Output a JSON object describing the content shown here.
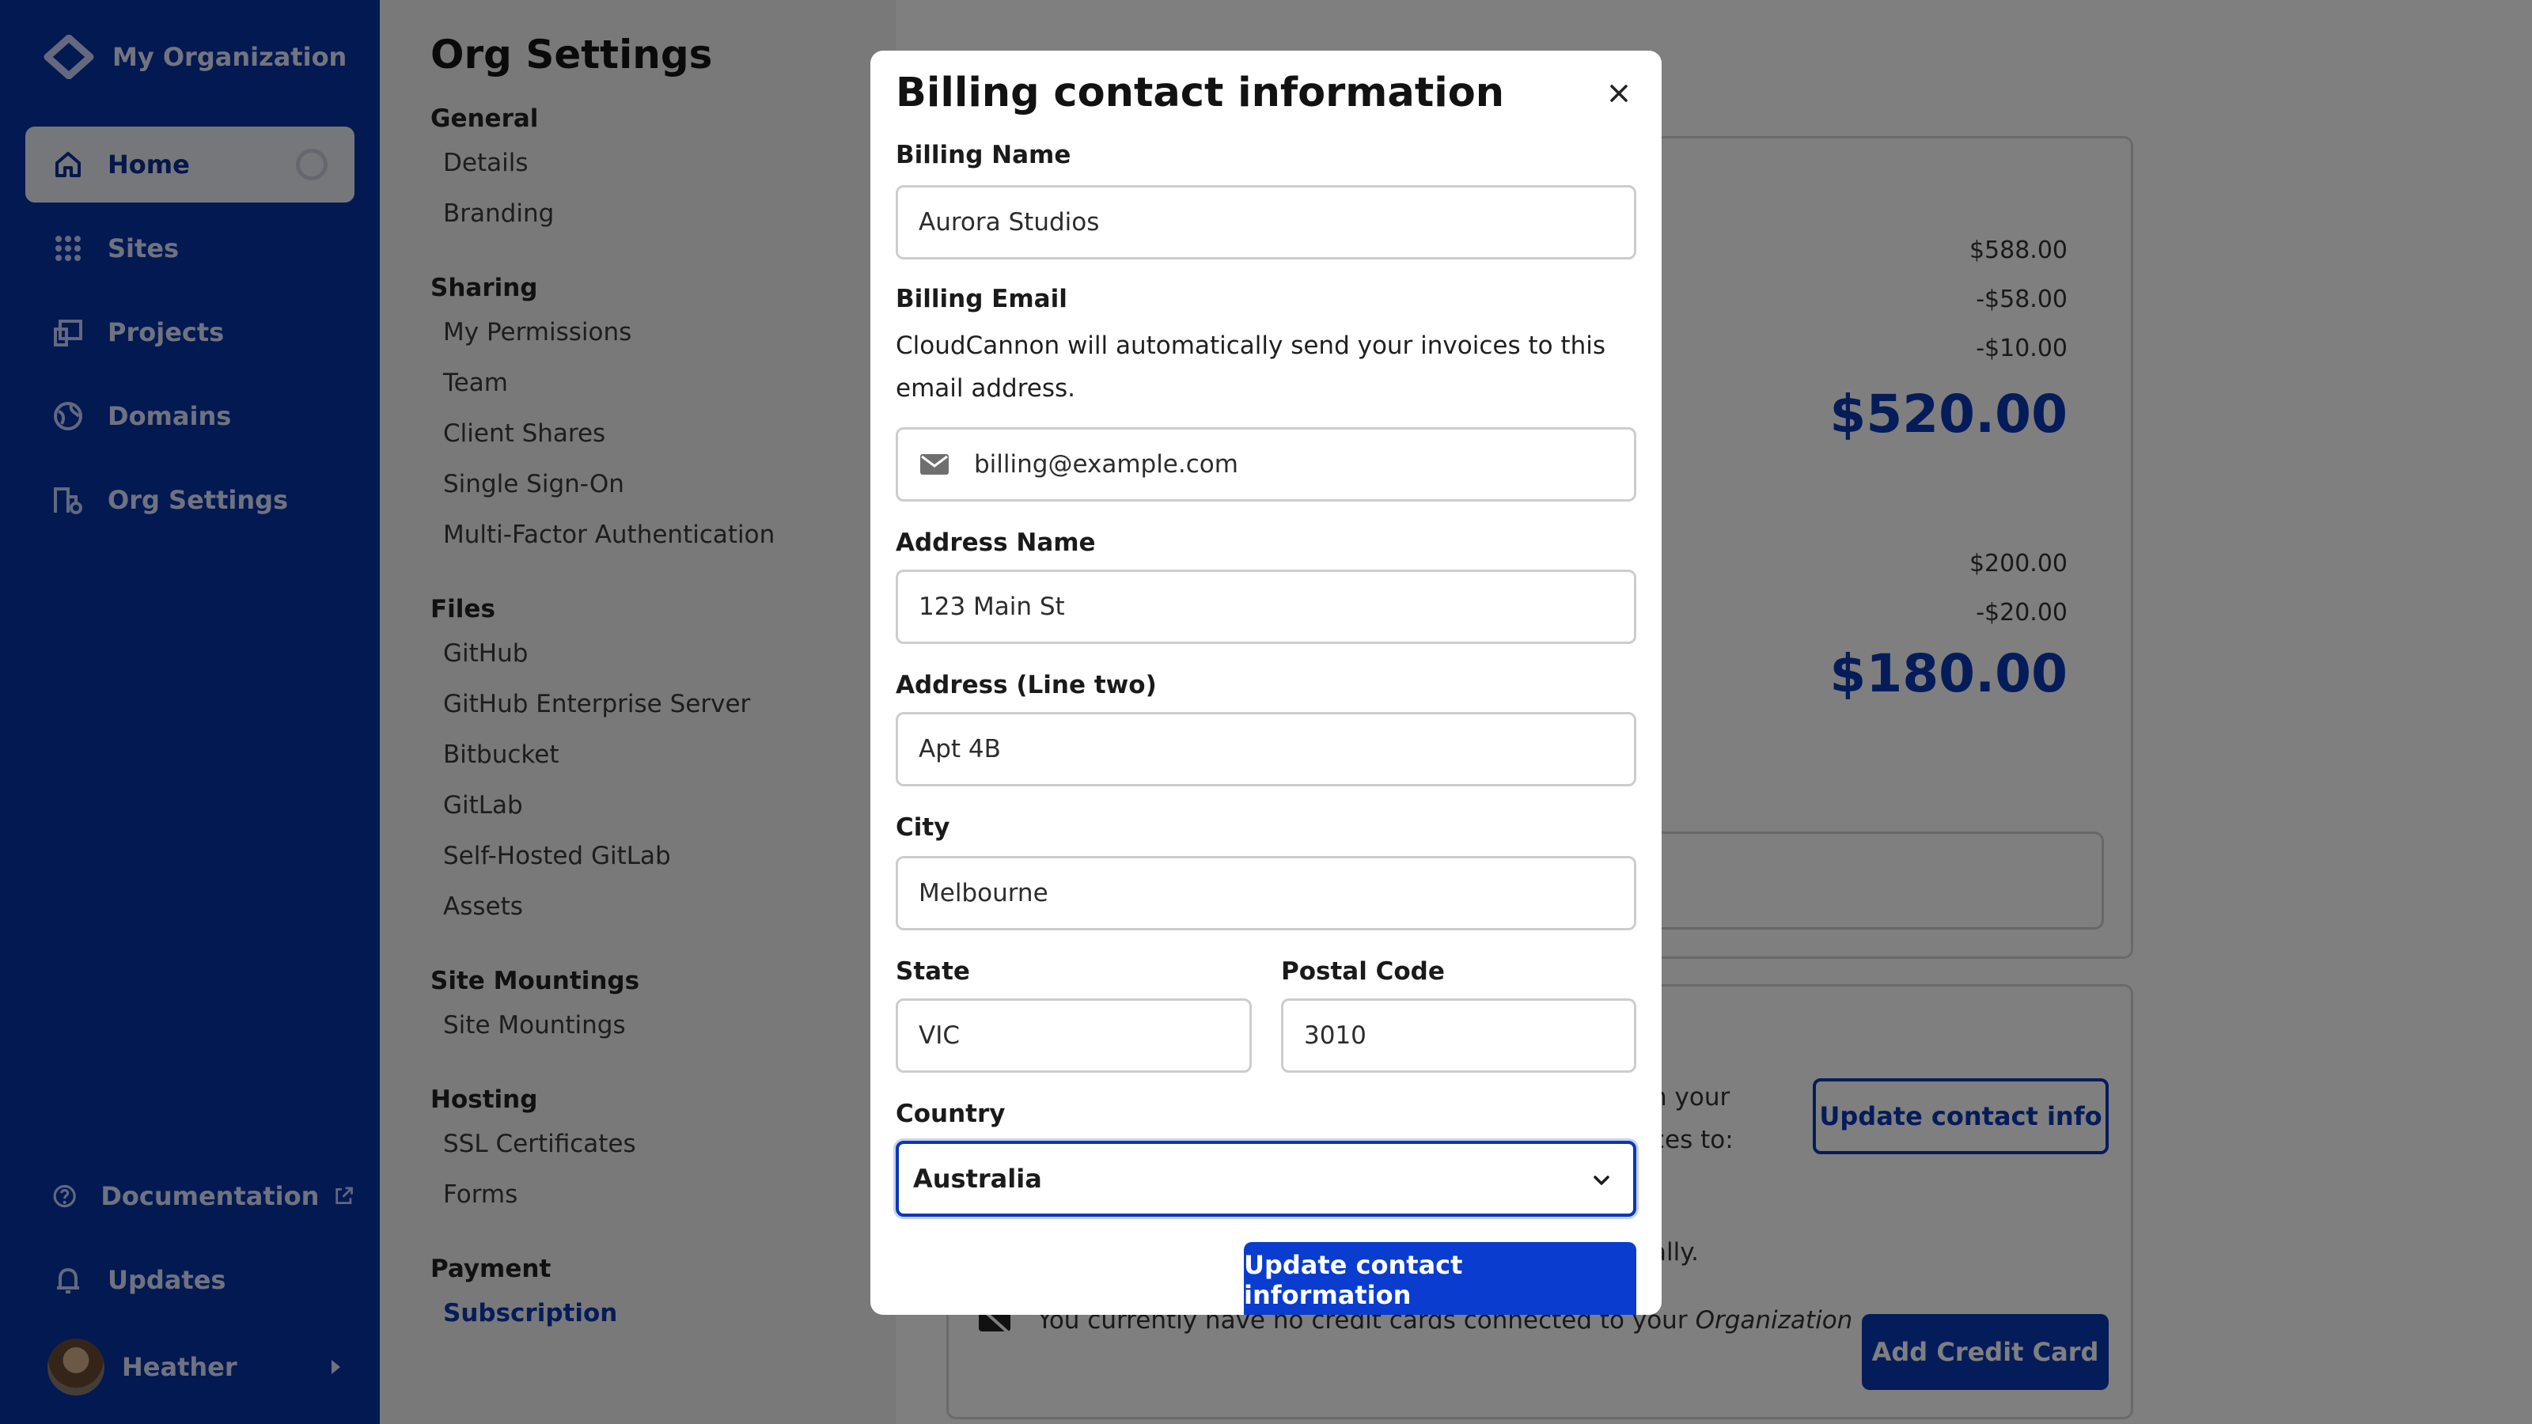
{
  "sidebar": {
    "org_name": "My Organization",
    "nav": [
      {
        "label": "Home",
        "icon": "home-icon"
      },
      {
        "label": "Sites",
        "icon": "grid-icon"
      },
      {
        "label": "Projects",
        "icon": "projects-icon"
      },
      {
        "label": "Domains",
        "icon": "globe-icon"
      },
      {
        "label": "Org Settings",
        "icon": "org-settings-icon"
      }
    ],
    "bottom": [
      {
        "label": "Documentation",
        "icon": "help-icon"
      },
      {
        "label": "Updates",
        "icon": "bell-icon"
      }
    ],
    "user": "Heather"
  },
  "settings": {
    "title": "Org Settings",
    "sections": [
      {
        "heading": "General",
        "items": [
          "Details",
          "Branding"
        ]
      },
      {
        "heading": "Sharing",
        "items": [
          "My Permissions",
          "Team",
          "Client Shares",
          "Single Sign-On",
          "Multi-Factor Authentication"
        ]
      },
      {
        "heading": "Files",
        "items": [
          "GitHub",
          "GitHub Enterprise Server",
          "Bitbucket",
          "GitLab",
          "Self-Hosted GitLab",
          "Assets"
        ]
      },
      {
        "heading": "Site Mountings",
        "items": [
          "Site Mountings"
        ]
      },
      {
        "heading": "Hosting",
        "items": [
          "SSL Certificates",
          "Forms"
        ]
      },
      {
        "heading": "Payment",
        "items": [
          "Subscription"
        ]
      }
    ]
  },
  "background": {
    "amounts_1": [
      "$588.00",
      "-$58.00",
      "-$10.00"
    ],
    "total_1": "$520.00",
    "amounts_2": [
      "$200.00",
      "-$20.00"
    ],
    "total_2": "$180.00",
    "fragment_1": "n your",
    "fragment_2": "ces to:",
    "fragment_3": "ally.",
    "update_contact_info": "Update contact info",
    "no_cards_text": "You currently have no credit cards connected to your",
    "no_cards_emph": "Organization",
    "add_credit_card": "Add Credit Card"
  },
  "modal": {
    "title": "Billing contact information",
    "billing_name_label": "Billing Name",
    "billing_name_value": "Aurora Studios",
    "billing_email_label": "Billing Email",
    "billing_email_help": "CloudCannon will automatically send your invoices to this email address.",
    "billing_email_value": "billing@example.com",
    "address_name_label": "Address Name",
    "address_name_value": "123 Main St",
    "address_two_label": "Address (Line two)",
    "address_two_value": "Apt 4B",
    "city_label": "City",
    "city_value": "Melbourne",
    "state_label": "State",
    "state_value": "VIC",
    "postal_label": "Postal Code",
    "postal_value": "3010",
    "country_label": "Country",
    "country_value": "Australia",
    "submit_label": "Update contact information"
  }
}
